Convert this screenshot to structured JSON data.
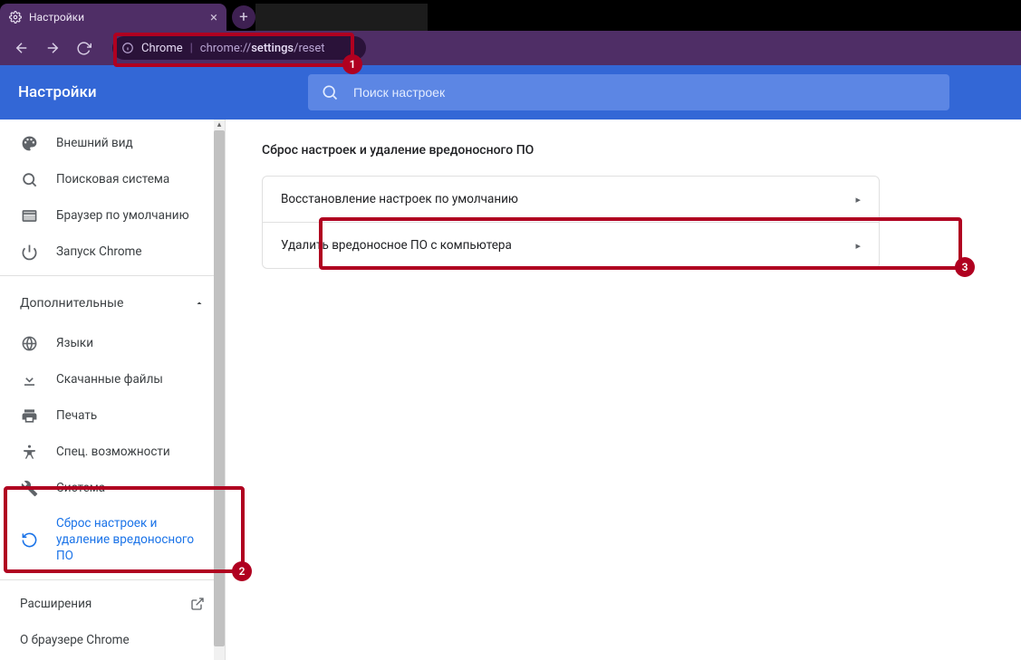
{
  "tabstrip": {
    "active_tab_title": "Настройки",
    "new_tab_button": "+"
  },
  "toolbar": {
    "omnibox_chip": "Chrome",
    "omnibox_url_pre": "chrome://",
    "omnibox_url_bold": "settings",
    "omnibox_url_post": "/reset"
  },
  "annotations": {
    "one": "1",
    "two": "2",
    "three": "3"
  },
  "header": {
    "title": "Настройки",
    "search_placeholder": "Поиск настроек"
  },
  "sidebar": {
    "items": [
      {
        "icon": "palette",
        "label": "Внешний вид"
      },
      {
        "icon": "search",
        "label": "Поисковая система"
      },
      {
        "icon": "browser",
        "label": "Браузер по умолчанию"
      },
      {
        "icon": "power",
        "label": "Запуск Chrome"
      }
    ],
    "advanced_label": "Дополнительные",
    "adv_items": [
      {
        "icon": "globe",
        "label": "Языки"
      },
      {
        "icon": "download",
        "label": "Скачанные файлы"
      },
      {
        "icon": "print",
        "label": "Печать"
      },
      {
        "icon": "accessibility",
        "label": "Спец. возможности"
      },
      {
        "icon": "wrench",
        "label": "Система"
      },
      {
        "icon": "reset",
        "label": "Сброс настроек и удаление вредоносного ПО",
        "active": true
      }
    ],
    "extensions_label": "Расширения",
    "about_label": "О браузере Chrome"
  },
  "content": {
    "heading": "Сброс настроек и удаление вредоносного ПО",
    "rows": [
      "Восстановление настроек по умолчанию",
      "Удалить вредоносное ПО с компьютера"
    ]
  }
}
